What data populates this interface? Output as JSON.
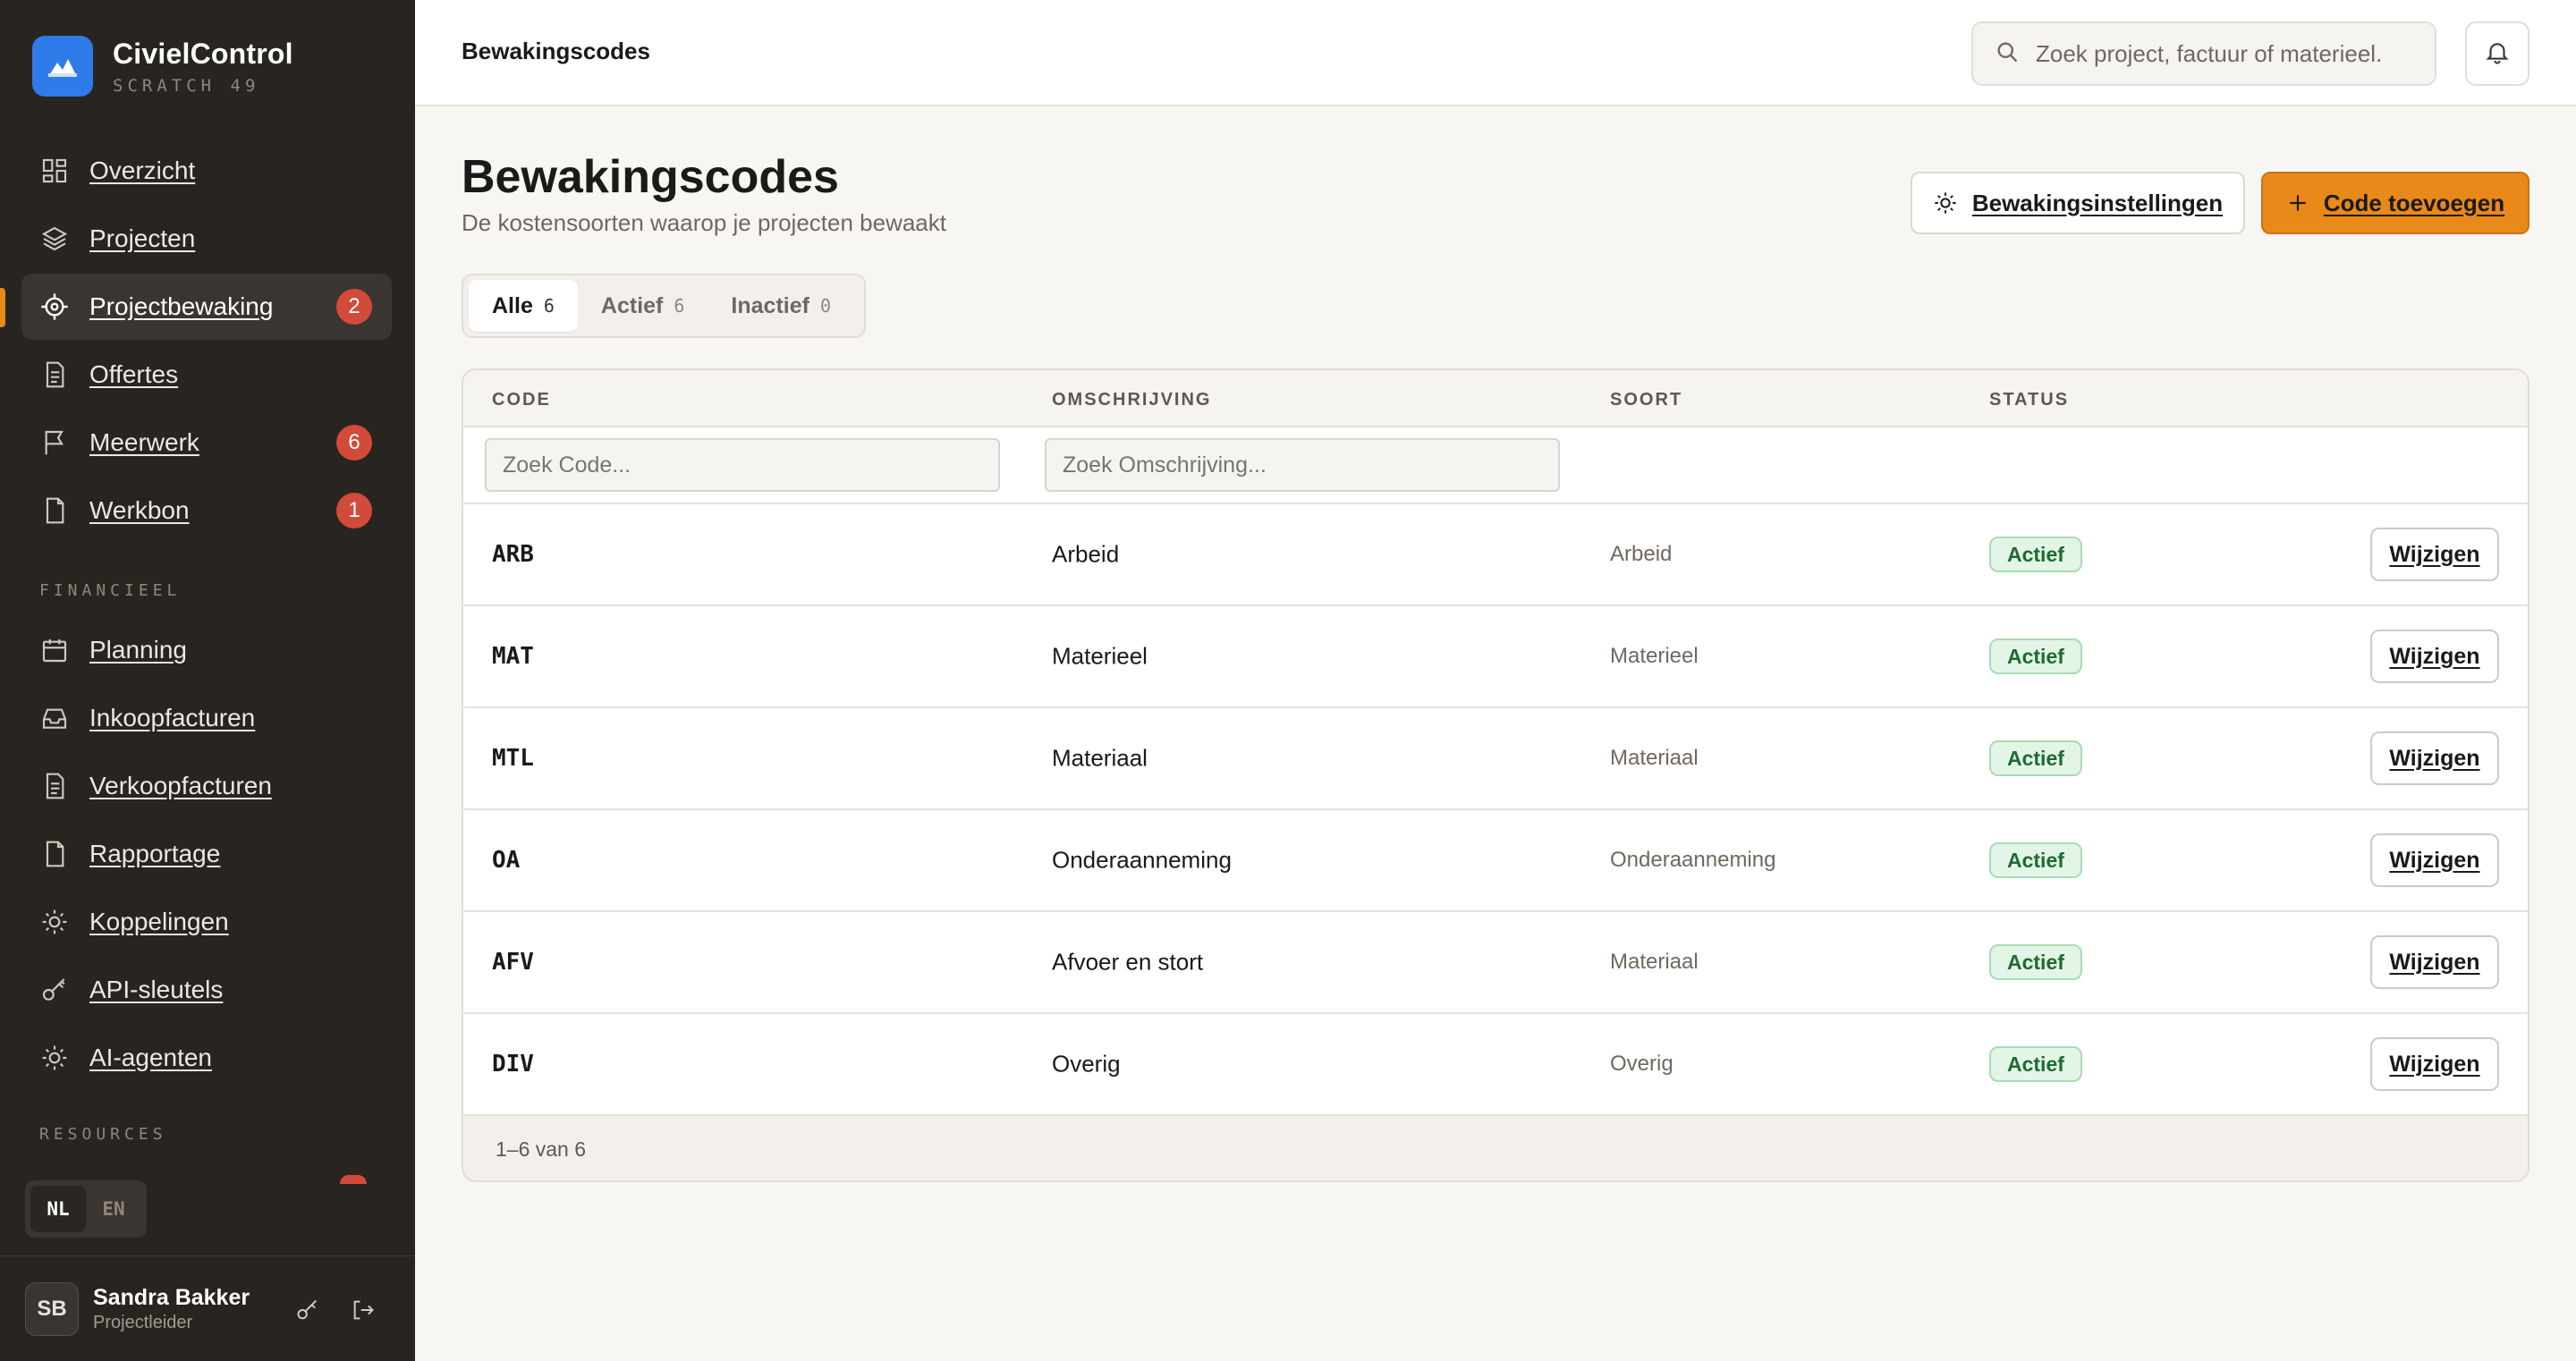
{
  "app": {
    "name": "CivielControl",
    "subtitle": "SCRATCH 49"
  },
  "sidebar": {
    "items": [
      {
        "label": "Overzicht",
        "icon": "grid-icon"
      },
      {
        "label": "Projecten",
        "icon": "layers-icon"
      },
      {
        "label": "Projectbewaking",
        "icon": "crosshair-icon",
        "badge": "2",
        "active": true
      },
      {
        "label": "Offertes",
        "icon": "document-icon"
      },
      {
        "label": "Meerwerk",
        "icon": "flag-icon",
        "badge": "6"
      },
      {
        "label": "Werkbon",
        "icon": "file-icon",
        "badge": "1"
      }
    ],
    "section_financieel": "FINANCIEEL",
    "financieel_items": [
      {
        "label": "Planning",
        "icon": "calendar-icon"
      },
      {
        "label": "Inkoopfacturen",
        "icon": "inbox-icon"
      },
      {
        "label": "Verkoopfacturen",
        "icon": "document-icon"
      },
      {
        "label": "Rapportage",
        "icon": "file-icon"
      },
      {
        "label": "Koppelingen",
        "icon": "sun-icon"
      },
      {
        "label": "API-sleutels",
        "icon": "key-icon"
      },
      {
        "label": "AI-agenten",
        "icon": "sun-icon"
      }
    ],
    "section_resources": "RESOURCES",
    "lang": {
      "nl": "NL",
      "en": "EN",
      "selected": "NL"
    }
  },
  "user": {
    "initials": "SB",
    "name": "Sandra Bakker",
    "role": "Projectleider"
  },
  "topbar": {
    "breadcrumb": "Bewakingscodes",
    "search_placeholder": "Zoek project, factuur of materieel."
  },
  "page": {
    "title": "Bewakingscodes",
    "subtitle": "De kostensoorten waarop je projecten bewaakt",
    "settings_button": "Bewakingsinstellingen",
    "add_button": "Code toevoegen"
  },
  "tabs": [
    {
      "label": "Alle",
      "count": "6",
      "active": true
    },
    {
      "label": "Actief",
      "count": "6"
    },
    {
      "label": "Inactief",
      "count": "0"
    }
  ],
  "table": {
    "headers": {
      "code": "CODE",
      "desc": "OMSCHRIJVING",
      "kind": "SOORT",
      "status": "STATUS"
    },
    "filters": {
      "code_placeholder": "Zoek Code...",
      "desc_placeholder": "Zoek Omschrijving..."
    },
    "edit_label": "Wijzigen",
    "rows": [
      {
        "code": "ARB",
        "desc": "Arbeid",
        "kind": "Arbeid",
        "status": "Actief"
      },
      {
        "code": "MAT",
        "desc": "Materieel",
        "kind": "Materieel",
        "status": "Actief"
      },
      {
        "code": "MTL",
        "desc": "Materiaal",
        "kind": "Materiaal",
        "status": "Actief"
      },
      {
        "code": "OA",
        "desc": "Onderaanneming",
        "kind": "Onderaanneming",
        "status": "Actief"
      },
      {
        "code": "AFV",
        "desc": "Afvoer en stort",
        "kind": "Materiaal",
        "status": "Actief"
      },
      {
        "code": "DIV",
        "desc": "Overig",
        "kind": "Overig",
        "status": "Actief"
      }
    ],
    "footer": "1–6 van 6"
  },
  "colors": {
    "accent": "#e8891a",
    "brand": "#2f7bea",
    "badge": "#d24a3a",
    "sidebar": "#28241f"
  }
}
